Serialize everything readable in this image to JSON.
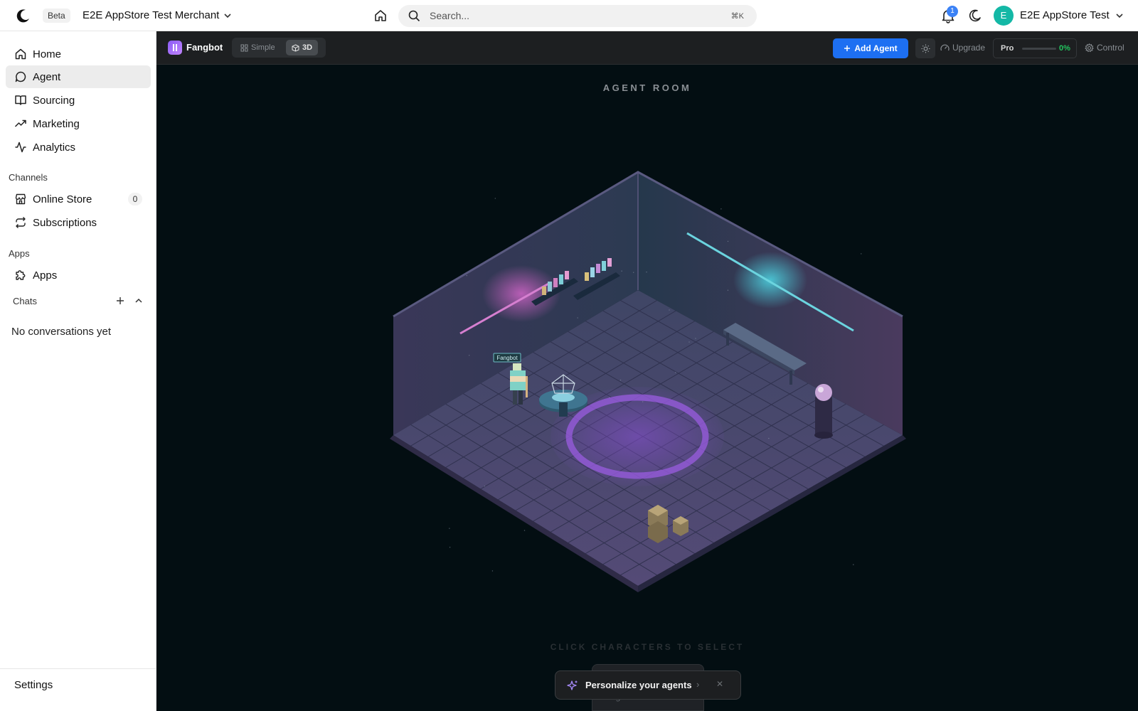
{
  "topbar": {
    "beta_label": "Beta",
    "merchant_name": "E2E AppStore Test Merchant",
    "search_placeholder": "Search...",
    "search_shortcut": "⌘K",
    "notification_count": "1",
    "user_initial": "E",
    "user_name": "E2E AppStore Test"
  },
  "sidebar": {
    "items": [
      {
        "label": "Home",
        "icon": "home-icon"
      },
      {
        "label": "Agent",
        "icon": "chat-bubble-icon",
        "active": true
      },
      {
        "label": "Sourcing",
        "icon": "book-icon"
      },
      {
        "label": "Marketing",
        "icon": "trending-up-icon"
      },
      {
        "label": "Analytics",
        "icon": "activity-icon"
      }
    ],
    "channels_label": "Channels",
    "channels": [
      {
        "label": "Online Store",
        "icon": "store-icon",
        "count": "0"
      },
      {
        "label": "Subscriptions",
        "icon": "repeat-icon"
      }
    ],
    "apps_label": "Apps",
    "apps": [
      {
        "label": "Apps",
        "icon": "puzzle-icon"
      }
    ],
    "chats_label": "Chats",
    "no_conversations": "No conversations yet",
    "settings_label": "Settings"
  },
  "toolbar": {
    "agent_name": "Fangbot",
    "view_simple": "Simple",
    "view_3d": "3D",
    "active_view": "3D",
    "add_agent": "Add Agent",
    "upgrade": "Upgrade",
    "plan_label": "Pro",
    "plan_progress": "0%",
    "control": "Control"
  },
  "room": {
    "title": "AGENT ROOM",
    "character_label": "Fangbot",
    "hint": "CLICK CHARACTERS TO SELECT",
    "selected_card_label": "Mage"
  },
  "toast": {
    "text": "Personalize your agents"
  },
  "colors": {
    "accent_blue": "#1d6ff2",
    "room_bg": "#030e12",
    "floor": "#4a4470",
    "rune_circle": "#8b4fd8",
    "progress_green": "#22c55e"
  }
}
